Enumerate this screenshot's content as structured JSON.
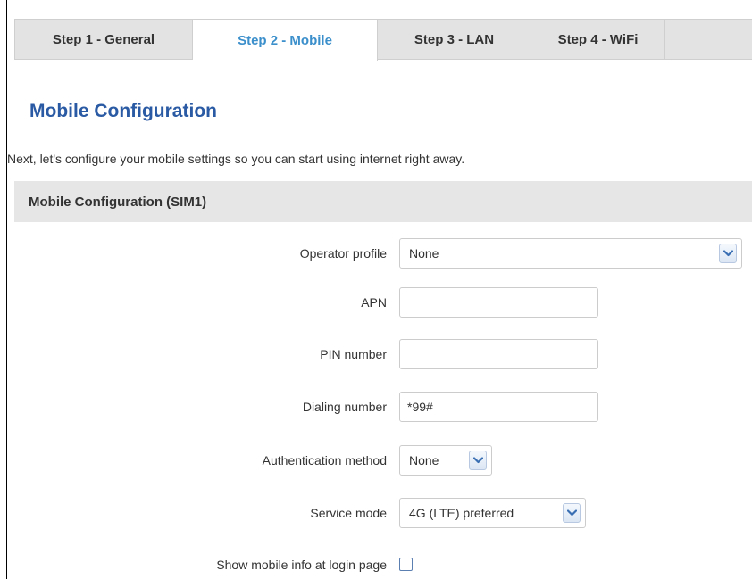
{
  "tabs": [
    {
      "label": "Step 1 - General",
      "active": false
    },
    {
      "label": "Step 2 - Mobile",
      "active": true
    },
    {
      "label": "Step 3 - LAN",
      "active": false
    },
    {
      "label": "Step 4 - WiFi",
      "active": false
    }
  ],
  "page": {
    "title": "Mobile Configuration",
    "intro": "Next, let's configure your mobile settings so you can start using internet right away."
  },
  "section": {
    "header": "Mobile Configuration (SIM1)"
  },
  "form": {
    "operator_profile": {
      "label": "Operator profile",
      "value": "None",
      "icon": "chevron-down-icon"
    },
    "apn": {
      "label": "APN",
      "value": ""
    },
    "pin": {
      "label": "PIN number",
      "value": ""
    },
    "dialing": {
      "label": "Dialing number",
      "value": "*99#"
    },
    "auth": {
      "label": "Authentication method",
      "value": "None",
      "icon": "chevron-down-icon"
    },
    "service_mode": {
      "label": "Service mode",
      "value": "4G (LTE) preferred",
      "icon": "chevron-down-icon"
    },
    "show_info": {
      "label": "Show mobile info at login page",
      "checked": false
    }
  },
  "colors": {
    "active_tab": "#3b8fcb",
    "title": "#2a5aa3",
    "tab_bar": "#e3e3e3",
    "section_header": "#e6e6e6",
    "arrow_accent": "#3a6fb4"
  }
}
